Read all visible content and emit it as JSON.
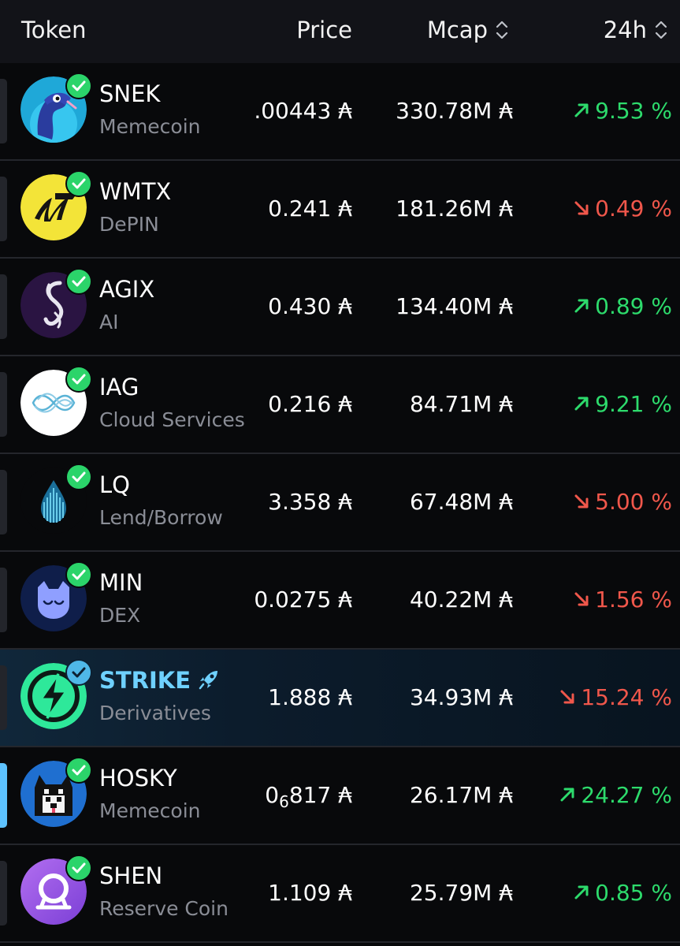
{
  "header": {
    "token_label": "Token",
    "price_label": "Price",
    "mcap_label": "Mcap",
    "change_label": "24h"
  },
  "colors": {
    "background": "#08090b",
    "header_bg": "#121318",
    "up": "#2ddb6c",
    "down": "#f0574b",
    "verified": "#2bd46a",
    "highlight_text": "#6fd1ff",
    "active_rail": "#5dc2ff"
  },
  "rows": [
    {
      "symbol": "SNEK",
      "category": "Memecoin",
      "price": ".00443 ₳",
      "mcap": "330.78M ₳",
      "change": "9.53 %",
      "direction": "up",
      "icon": "snake-logo-icon"
    },
    {
      "symbol": "WMTX",
      "category": "DePIN",
      "price": "0.241 ₳",
      "mcap": "181.26M ₳",
      "change": "0.49 %",
      "direction": "down",
      "icon": "wmtx-logo-icon"
    },
    {
      "symbol": "AGIX",
      "category": "AI",
      "price": "0.430 ₳",
      "mcap": "134.40M ₳",
      "change": "0.89 %",
      "direction": "up",
      "icon": "agix-logo-icon"
    },
    {
      "symbol": "IAG",
      "category": "Cloud Services",
      "price": "0.216 ₳",
      "mcap": "84.71M ₳",
      "change": "9.21 %",
      "direction": "up",
      "icon": "iag-logo-icon"
    },
    {
      "symbol": "LQ",
      "category": "Lend/Borrow",
      "price": "3.358 ₳",
      "mcap": "67.48M ₳",
      "change": "5.00 %",
      "direction": "down",
      "icon": "liqwid-drop-icon"
    },
    {
      "symbol": "MIN",
      "category": "DEX",
      "price": "0.0275 ₳",
      "mcap": "40.22M ₳",
      "change": "1.56 %",
      "direction": "down",
      "icon": "minswap-cat-icon"
    },
    {
      "symbol": "STRIKE",
      "category": "Derivatives",
      "price": "1.888 ₳",
      "mcap": "34.93M ₳",
      "change": "15.24 %",
      "direction": "down",
      "icon": "strike-logo-icon",
      "highlight": true
    },
    {
      "symbol": "HOSKY",
      "category": "Memecoin",
      "price_prefix": "0",
      "price_sub": "6",
      "price_rest": "817 ₳",
      "mcap": "26.17M ₳",
      "change": "24.27 %",
      "direction": "up",
      "icon": "husky-logo-icon",
      "active": true
    },
    {
      "symbol": "SHEN",
      "category": "Reserve Coin",
      "price": "1.109 ₳",
      "mcap": "25.79M ₳",
      "change": "0.85 %",
      "direction": "up",
      "icon": "shen-logo-icon"
    }
  ]
}
